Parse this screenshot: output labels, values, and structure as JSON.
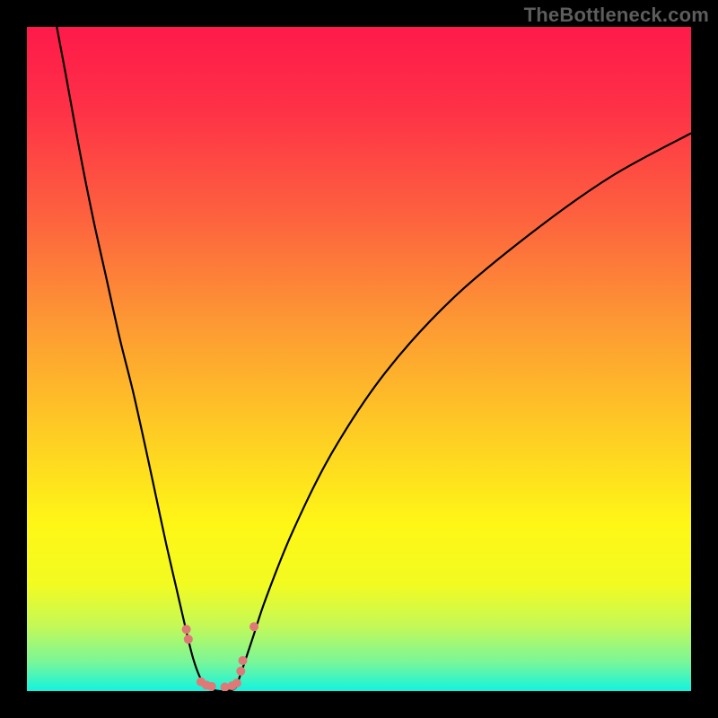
{
  "watermark": "TheBottleneck.com",
  "colors": {
    "frame": "#000000",
    "gradient_stops": [
      {
        "offset": 0.0,
        "color": "#fe1a4a"
      },
      {
        "offset": 0.12,
        "color": "#fe3047"
      },
      {
        "offset": 0.28,
        "color": "#fd603f"
      },
      {
        "offset": 0.45,
        "color": "#fd9a33"
      },
      {
        "offset": 0.62,
        "color": "#fecf23"
      },
      {
        "offset": 0.75,
        "color": "#fef716"
      },
      {
        "offset": 0.84,
        "color": "#f2fb21"
      },
      {
        "offset": 0.9,
        "color": "#c6f955"
      },
      {
        "offset": 0.955,
        "color": "#7cf697"
      },
      {
        "offset": 1.0,
        "color": "#13f3e0"
      }
    ],
    "curve_stroke": "#000000",
    "marker_fill": "#e07878",
    "marker_stroke": "#c85f5f"
  },
  "chart_data": {
    "type": "line",
    "title": "",
    "xlabel": "",
    "ylabel": "",
    "xlim": [
      0,
      100
    ],
    "ylim": [
      0,
      100
    ],
    "curve_left": {
      "x": [
        4.5,
        6,
        8,
        10,
        12,
        14,
        16,
        18,
        19.5,
        21,
        22.5,
        24,
        25,
        26,
        27
      ],
      "y": [
        100,
        92,
        81,
        71,
        62,
        53,
        45,
        36,
        29,
        22,
        15.5,
        9,
        5,
        2.2,
        0.6
      ]
    },
    "curve_right": {
      "x": [
        31.5,
        32.5,
        34,
        36,
        40,
        46,
        54,
        64,
        76,
        88,
        100
      ],
      "y": [
        0.6,
        3.5,
        8,
        14,
        24,
        36,
        48,
        59,
        69,
        77.5,
        84
      ]
    },
    "trough": {
      "x": [
        27,
        28,
        29,
        30,
        31,
        31.5
      ],
      "y": [
        0.6,
        0.2,
        0.0,
        0.0,
        0.2,
        0.6
      ]
    },
    "markers": [
      {
        "x": 24.0,
        "y": 9.3,
        "r": 5
      },
      {
        "x": 24.3,
        "y": 7.8,
        "r": 5
      },
      {
        "x": 26.2,
        "y": 1.4,
        "r": 5
      },
      {
        "x": 27.0,
        "y": 0.9,
        "r": 5
      },
      {
        "x": 27.8,
        "y": 0.7,
        "r": 5
      },
      {
        "x": 29.8,
        "y": 0.6,
        "r": 5
      },
      {
        "x": 30.9,
        "y": 0.8,
        "r": 5
      },
      {
        "x": 31.6,
        "y": 1.2,
        "r": 5
      },
      {
        "x": 32.2,
        "y": 3.0,
        "r": 5
      },
      {
        "x": 32.5,
        "y": 4.6,
        "r": 5
      },
      {
        "x": 34.2,
        "y": 9.7,
        "r": 5
      }
    ]
  }
}
